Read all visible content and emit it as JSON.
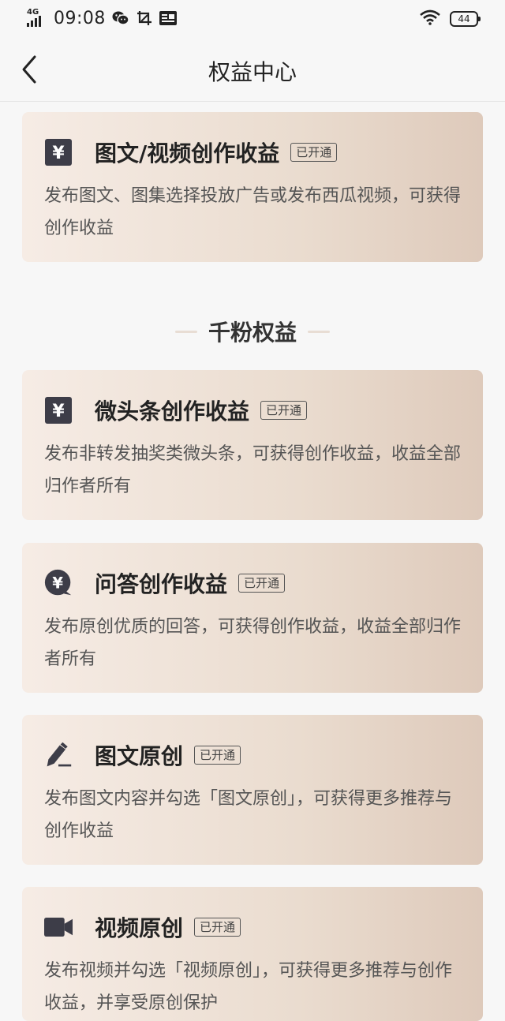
{
  "status_bar": {
    "network": "4G",
    "time": "09:08",
    "battery": "44",
    "icons": [
      "signal-icon",
      "wechat-icon",
      "screenshot-icon",
      "toutiao-icon",
      "wifi-icon",
      "battery-icon"
    ]
  },
  "nav": {
    "title": "权益中心",
    "back_icon": "chevron-left-icon"
  },
  "section": {
    "title": "千粉权益"
  },
  "cards": [
    {
      "title": "图文/视频创作收益",
      "badge": "已开通",
      "desc": "发布图文、图集选择投放广告或发布西瓜视频，可获得创作收益",
      "icon": "yuan-square-icon"
    },
    {
      "title": "微头条创作收益",
      "badge": "已开通",
      "desc": "发布非转发抽奖类微头条，可获得创作收益，收益全部归作者所有",
      "icon": "yuan-square-icon"
    },
    {
      "title": "问答创作收益",
      "badge": "已开通",
      "desc": "发布原创优质的回答，可获得创作收益，收益全部归作者所有",
      "icon": "yuan-bubble-icon"
    },
    {
      "title": "图文原创",
      "badge": "已开通",
      "desc": "发布图文内容并勾选「图文原创」，可获得更多推荐与创作收益",
      "icon": "pen-icon"
    },
    {
      "title": "视频原创",
      "badge": "已开通",
      "desc": "发布视频并勾选「视频原创」，可获得更多推荐与创作收益，并享受原创保护",
      "icon": "video-camera-icon"
    }
  ],
  "colors": {
    "icon_dark": "#3d3d48",
    "card_start": "#f6ece5",
    "card_end": "#decabb",
    "page_bg": "#f7f7f7"
  }
}
